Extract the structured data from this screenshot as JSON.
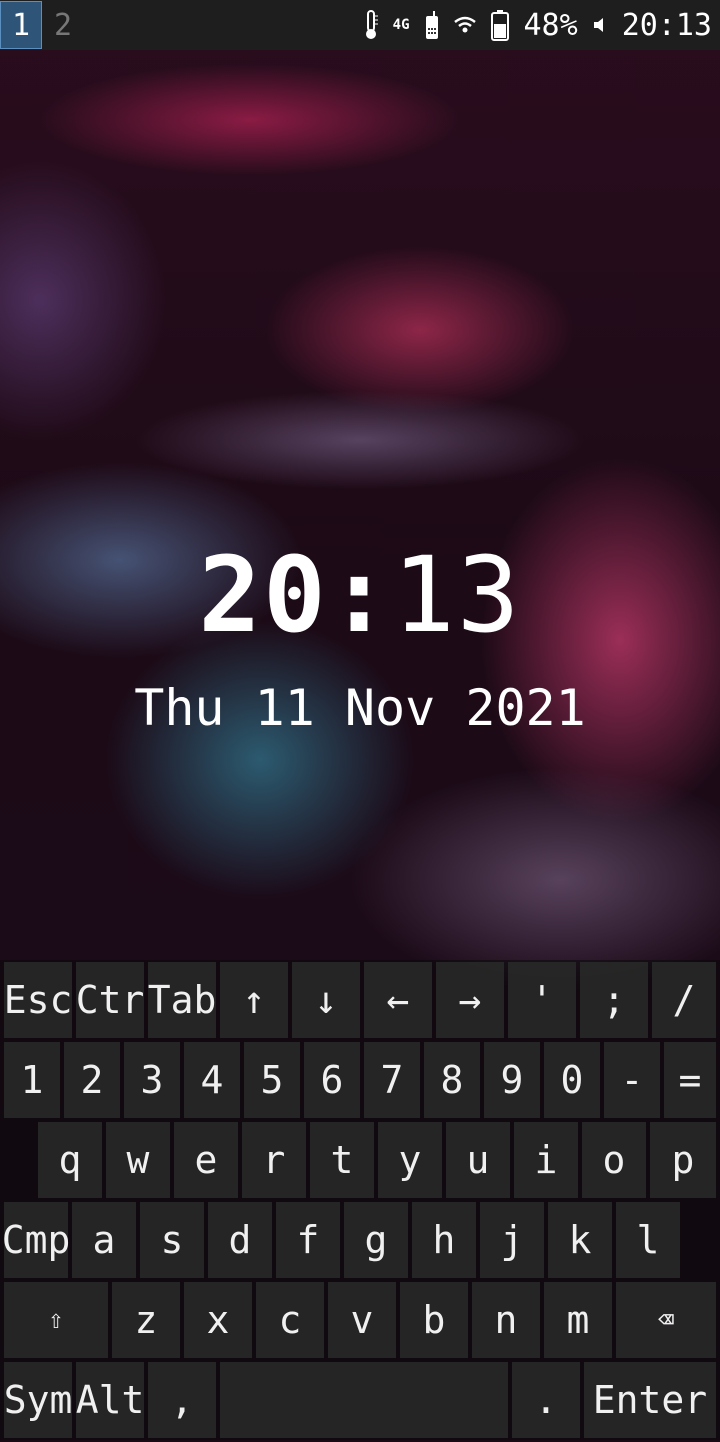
{
  "statusbar": {
    "workspaces": [
      "1",
      "2"
    ],
    "network": "4G",
    "battery": "48%",
    "time": "20:13"
  },
  "lockscreen": {
    "hours": "20",
    "separator": ":",
    "minutes": "13",
    "date": "Thu 11 Nov 2021"
  },
  "keyboard": {
    "row1": [
      "Esc",
      "Ctr",
      "Tab",
      "↑",
      "↓",
      "←",
      "→",
      "'",
      ";",
      "/"
    ],
    "row2": [
      "1",
      "2",
      "3",
      "4",
      "5",
      "6",
      "7",
      "8",
      "9",
      "0",
      "-",
      "="
    ],
    "row3": [
      "q",
      "w",
      "e",
      "r",
      "t",
      "y",
      "u",
      "i",
      "o",
      "p"
    ],
    "row4": [
      "Cmp",
      "a",
      "s",
      "d",
      "f",
      "g",
      "h",
      "j",
      "k",
      "l"
    ],
    "row5": [
      "⇧",
      "z",
      "x",
      "c",
      "v",
      "b",
      "n",
      "m",
      "⌫"
    ],
    "row6": [
      "Sym",
      "Alt",
      ",",
      "",
      ".",
      "Enter"
    ]
  }
}
